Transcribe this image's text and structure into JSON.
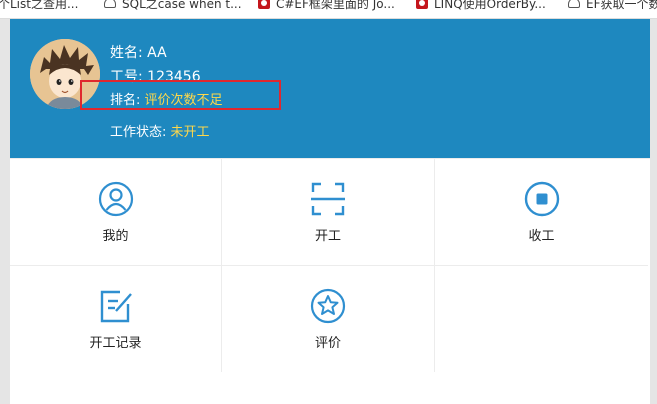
{
  "bookmarks": [
    {
      "label": "个List之查用...",
      "icon": "cloud-icon"
    },
    {
      "label": "SQL之case when t...",
      "icon": "cloud-icon"
    },
    {
      "label": "C#EF框架里面的 Jo...",
      "icon": "csdn-icon"
    },
    {
      "label": "LINQ使用OrderBy...",
      "icon": "csdn-icon"
    },
    {
      "label": "EF获取一个数...",
      "icon": "cloud-icon"
    }
  ],
  "profile": {
    "name_label": "姓名:",
    "name_value": "AA",
    "id_label": "工号:",
    "id_value": "123456",
    "rank_label": "排名:",
    "rank_value": "评价次数不足",
    "status_label": "工作状态:",
    "status_value": "未开工"
  },
  "menu": [
    {
      "label": "我的",
      "icon": "user-circle-icon"
    },
    {
      "label": "开工",
      "icon": "scan-icon"
    },
    {
      "label": "收工",
      "icon": "stop-circle-icon"
    },
    {
      "label": "开工记录",
      "icon": "edit-icon"
    },
    {
      "label": "评价",
      "icon": "star-circle-icon"
    }
  ],
  "colors": {
    "header_bg": "#1e88bf",
    "icon_blue": "#2f8fd0",
    "warn_yellow": "#ffd84a",
    "highlight_red": "#e0282e"
  }
}
